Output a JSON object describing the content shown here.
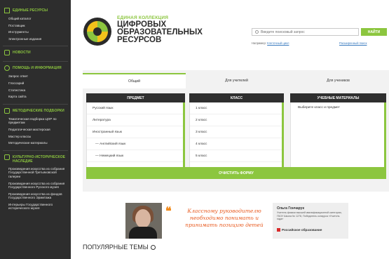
{
  "sidebar": {
    "sections": [
      {
        "title": "Единые Ресурсы",
        "icon": "home-icon",
        "items": [
          "Общий каталог",
          "Поставщик",
          "Инструменты",
          "Электронные издания"
        ]
      },
      {
        "title": "Новости",
        "icon": "news-icon",
        "items": []
      },
      {
        "title": "Помощь и информация",
        "icon": "help-icon",
        "items": [
          "Запрос ответ",
          "Глоссарий",
          "Статистика",
          "Карта сайта"
        ]
      },
      {
        "title": "Методические подборки",
        "icon": "book-icon",
        "items": [
          "Тематическая подборка ЦОР по предметам",
          "Педагогическая мастерская",
          "Мастер классы",
          "Методические материалы"
        ]
      },
      {
        "title": "Культурно-историческое наследие",
        "icon": "heritage-icon",
        "items": [
          "Произведения искусства из собрания Государственной Третьяковской галереи",
          "Произведения искусства из собрания Государственного Русского музея",
          "Произведения искусства из фондов Государственного Эрмитажа",
          "Интерьеры Государственного исторического музея"
        ]
      }
    ]
  },
  "header": {
    "brand_subtitle": "Единая коллекция",
    "brand_title": "Цифровых образовательных ресурсов",
    "search_placeholder": "Введите поисковый запрос",
    "search_button": "Найти",
    "example_label": "Например:",
    "example_link": "Клеточный цикл",
    "advanced_search": "Расширенный поиск"
  },
  "catalog": {
    "tabs": [
      "Общий",
      "Для учителей",
      "Для учеников"
    ],
    "active_tab": 0,
    "columns": {
      "subject": {
        "title": "Предмет",
        "items": [
          "Русский язык",
          "Литература",
          "Иностранный язык",
          "— Английский язык",
          "— Немецкий язык"
        ]
      },
      "grade": {
        "title": "Класс",
        "items": [
          "1 класс",
          "2 класс",
          "3 класс",
          "4 класс",
          "5 класс"
        ]
      },
      "materials": {
        "title": "Учебные материалы",
        "hint": "Выберите класс и предмет"
      }
    },
    "clear_button": "Очистить форму"
  },
  "banner": {
    "quote": "Классному руководителю необходимо понимать и принимать позицию детей",
    "person_name": "Ольга Гончарук",
    "person_desc": "Учитель физики высшей квалификационной категории, ГБОУ Школа № 1278, Победитель конкурса «Учитель года»",
    "org": "Российское образование"
  },
  "popular_title": "Популярные темы",
  "colors": {
    "accent": "#8cc63f",
    "sidebar_bg": "#2d2d2d",
    "column_head": "#2f2f2f",
    "quote": "#e85a1f"
  }
}
